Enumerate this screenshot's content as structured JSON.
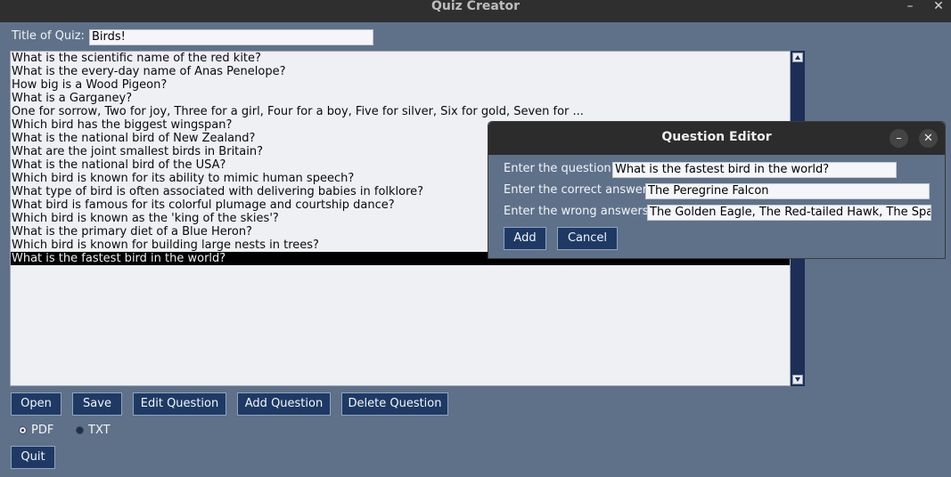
{
  "window": {
    "title": "Quiz Creator",
    "minimize": "–",
    "close": "✕"
  },
  "quiz": {
    "title_label": "Title of Quiz:",
    "title_value": "Birds!"
  },
  "questions": [
    "What is the scientific name of the red kite?",
    "What is the every-day name of Anas Penelope?",
    "How big is a Wood Pigeon?",
    "What is a Garganey?",
    "One for sorrow, Two for joy, Three for a girl, Four for a boy, Five for silver, Six for gold, Seven for ...",
    "Which bird has the biggest wingspan?",
    "What is the national bird of New Zealand?",
    "What are the joint smallest birds in Britain?",
    "What is the national bird of the USA?",
    "Which bird is known for its ability to mimic human speech?",
    "What type of bird is often associated with delivering babies in folklore?",
    "What bird is famous for its colorful plumage and courtship dance?",
    "Which bird is known as the 'king of the skies'?",
    "What is the primary diet of a Blue Heron?",
    "Which bird is known for building large nests in trees?",
    "What is the fastest bird in the world?"
  ],
  "selected_index": 15,
  "buttons": {
    "open": "Open",
    "save": "Save",
    "edit": "Edit Question",
    "add": "Add Question",
    "delete": "Delete Question",
    "quit": "Quit"
  },
  "format": {
    "pdf": "PDF",
    "txt": "TXT",
    "selected": "PDF"
  },
  "dialog": {
    "title": "Question Editor",
    "minimize": "–",
    "close": "✕",
    "question_label": "Enter the question:",
    "question_value": "What is the fastest bird in the world?",
    "correct_label": "Enter the correct answer:",
    "correct_value": "The Peregrine Falcon",
    "wrong_label": "Enter the wrong answers:",
    "wrong_value": "The Golden Eagle, The Red-tailed Hawk, The Sparrow",
    "add_button": "Add",
    "cancel_button": "Cancel"
  },
  "colors": {
    "background": "#5f7189",
    "button": "#1e3a64",
    "scrollbar": "#1d2f57",
    "titlebar": "#2f2f2f"
  }
}
